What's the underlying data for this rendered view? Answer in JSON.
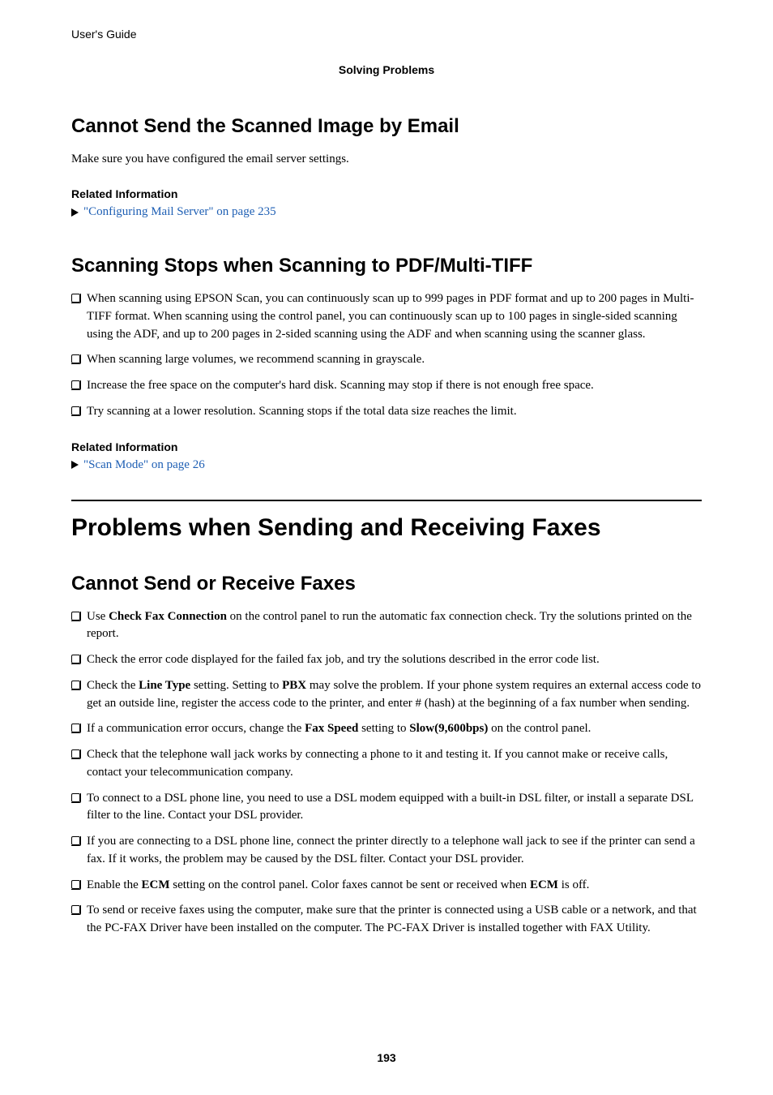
{
  "header": {
    "doc_title": "User's Guide",
    "section": "Solving Problems"
  },
  "sec1": {
    "heading": "Cannot Send the Scanned Image by Email",
    "body": "Make sure you have configured the email server settings.",
    "related_label": "Related Information",
    "link": "\"Configuring Mail Server\" on page 235"
  },
  "sec2": {
    "heading": "Scanning Stops when Scanning to PDF/Multi-TIFF",
    "bullets": [
      "When scanning using EPSON Scan, you can continuously scan up to 999 pages in PDF format and up to 200 pages in Multi-TIFF format. When scanning using the control panel, you can continuously scan up to 100 pages in single-sided scanning using the ADF, and up to 200 pages in 2-sided scanning using the ADF and when scanning using the scanner glass.",
      "When scanning large volumes, we recommend scanning in grayscale.",
      "Increase the free space on the computer's hard disk. Scanning may stop if there is not enough free space.",
      "Try scanning at a lower resolution. Scanning stops if the total data size reaches the limit."
    ],
    "related_label": "Related Information",
    "link": "\"Scan Mode\" on page 26"
  },
  "sec3": {
    "heading": "Problems when Sending and Receiving Faxes"
  },
  "sec4": {
    "heading": "Cannot Send or Receive Faxes",
    "bullets_html": [
      "Use <span class=\"bold\">Check Fax Connection</span> on the control panel to run the automatic fax connection check. Try the solutions printed on the report.",
      "Check the error code displayed for the failed fax job, and try the solutions described in the error code list.",
      "Check the <span class=\"bold\">Line Type</span> setting. Setting to <span class=\"bold\">PBX</span> may solve the problem. If your phone system requires an external access code to get an outside line, register the access code to the printer, and enter # (hash) at the beginning of a fax number when sending.",
      "If a communication error occurs, change the <span class=\"bold\">Fax Speed</span> setting to <span class=\"bold\">Slow(9,600bps)</span> on the control panel.",
      "Check that the telephone wall jack works by connecting a phone to it and testing it. If you cannot make or receive calls, contact your telecommunication company.",
      "To connect to a DSL phone line, you need to use a DSL modem equipped with a built-in DSL filter, or install a separate DSL filter to the line. Contact your DSL provider.",
      "If you are connecting to a DSL phone line, connect the printer directly to a telephone wall jack to see if the printer can send a fax. If it works, the problem may be caused by the DSL filter. Contact your DSL provider.",
      "Enable the <span class=\"bold\">ECM</span> setting on the control panel. Color faxes cannot be sent or received when <span class=\"bold\">ECM</span> is off.",
      "To send or receive faxes using the computer, make sure that the printer is connected using a USB cable or a network, and that the PC-FAX Driver have been installed on the computer. The PC-FAX Driver is installed together with FAX Utility."
    ]
  },
  "page_number": "193"
}
